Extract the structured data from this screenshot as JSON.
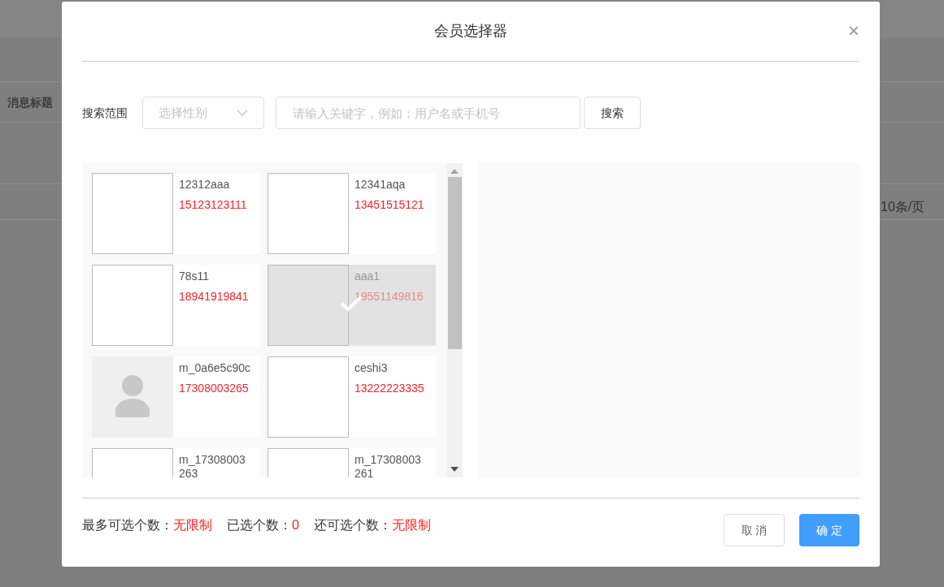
{
  "background": {
    "column_heading": "消息标题",
    "page_size": "10条/页"
  },
  "dialog": {
    "title": "会员选择器",
    "close": "×",
    "search": {
      "label": "搜索范围",
      "gender_select": {
        "placeholder": "选择性别"
      },
      "keyword": {
        "placeholder": "请输入关键字，例如：用户名或手机号"
      },
      "button": "搜索"
    },
    "members": [
      {
        "name": "12312aaa",
        "phone": "15123123111",
        "kind": "blank",
        "selected": false
      },
      {
        "name": "12341aqa",
        "phone": "13451515121",
        "kind": "blank",
        "selected": false
      },
      {
        "name": "78s11",
        "phone": "18941919841",
        "kind": "blank",
        "selected": false
      },
      {
        "name": "aaa1",
        "phone": "19551149816",
        "kind": "blank",
        "selected": true
      },
      {
        "name": "m_0a6e5c90c",
        "phone": "17308003265",
        "kind": "silhouette",
        "selected": false
      },
      {
        "name": "ceshi3",
        "phone": "13222223335",
        "kind": "blank",
        "selected": false
      },
      {
        "name": "m_17308003 263",
        "kind": "blank",
        "selected": false
      },
      {
        "name": "m_17308003 261",
        "kind": "blank",
        "selected": false
      }
    ],
    "stats": [
      {
        "label": "最多可选个数：",
        "value": "无限制"
      },
      {
        "label": "已选个数：",
        "value": "0"
      },
      {
        "label": "还可选个数：",
        "value": "无限制"
      }
    ],
    "buttons": [
      {
        "label": "取 消",
        "kind": "secondary"
      },
      {
        "label": "确 定",
        "kind": "primary"
      }
    ]
  }
}
